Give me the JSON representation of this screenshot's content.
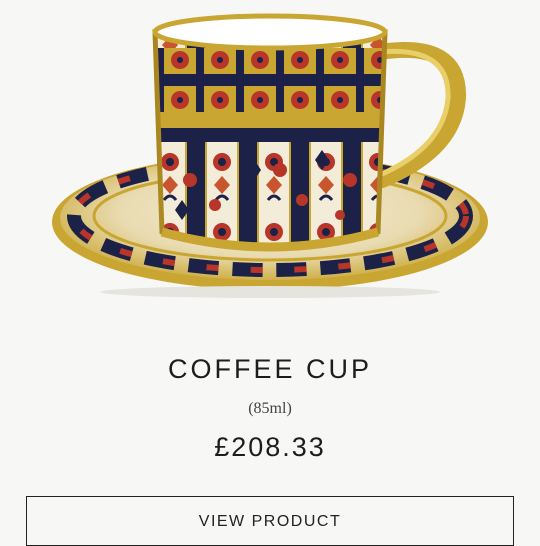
{
  "product": {
    "title": "COFFEE CUP",
    "volume": "(85ml)",
    "price": "£208.33",
    "button_label": "VIEW PRODUCT",
    "image_icon": "cup-and-saucer-icon"
  },
  "colors": {
    "background": "#f7f7f5",
    "gold": "#c9a632",
    "navy": "#1c2148",
    "red": "#b8352a",
    "cream": "#f3ecd8",
    "text": "#1d1d1d"
  }
}
